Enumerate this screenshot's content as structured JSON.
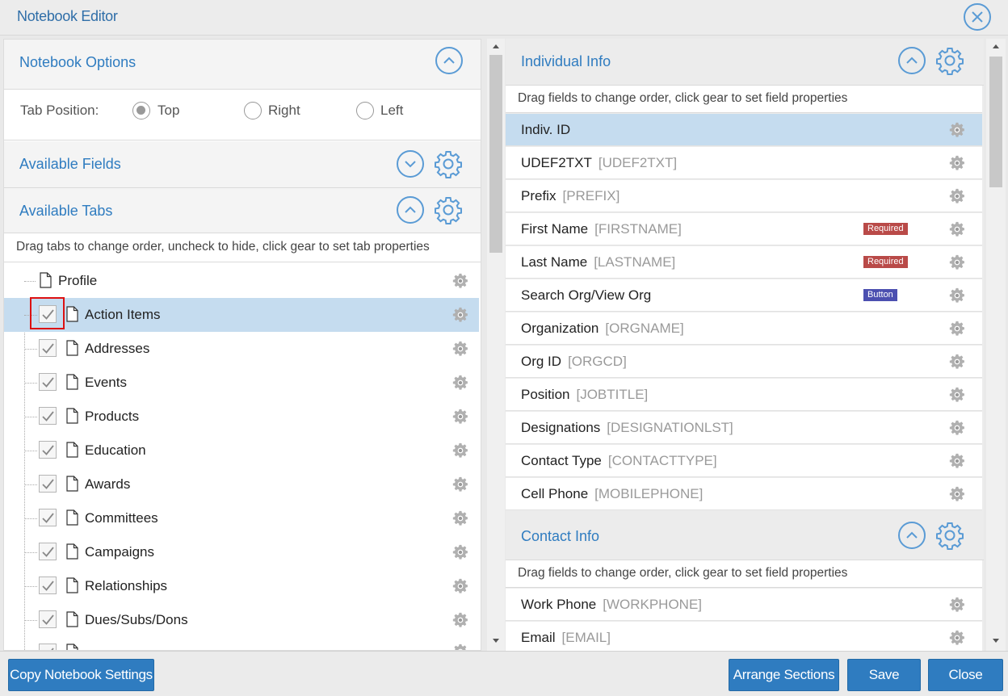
{
  "window": {
    "title": "Notebook Editor"
  },
  "icons": {
    "close": "close-circle-icon",
    "gear": "gear-icon",
    "chevron_up": "chevron-up-icon",
    "chevron_down": "chevron-down-icon",
    "document": "document-icon",
    "checkmark": "check-icon"
  },
  "colors": {
    "accent": "#2f7cc0",
    "selected_row": "#c5dcef",
    "required_badge": "#b94a48",
    "button_badge": "#4b4fb0"
  },
  "left": {
    "notebook_options": {
      "title": "Notebook Options",
      "tab_position_label": "Tab Position:",
      "options": [
        "Top",
        "Right",
        "Left"
      ],
      "selected": "Top"
    },
    "available_fields": {
      "title": "Available Fields"
    },
    "available_tabs": {
      "title": "Available Tabs",
      "hint": "Drag tabs to change order, uncheck to hide, click gear to set tab properties",
      "root": "Profile",
      "tabs": [
        {
          "label": "Action Items",
          "checked": true,
          "selected": true
        },
        {
          "label": "Addresses",
          "checked": true
        },
        {
          "label": "Events",
          "checked": true
        },
        {
          "label": "Products",
          "checked": true
        },
        {
          "label": "Education",
          "checked": true
        },
        {
          "label": "Awards",
          "checked": true
        },
        {
          "label": "Committees",
          "checked": true
        },
        {
          "label": "Campaigns",
          "checked": true
        },
        {
          "label": "Relationships",
          "checked": true
        },
        {
          "label": "Dues/Subs/Dons",
          "checked": true
        }
      ]
    }
  },
  "right": {
    "individual_info": {
      "title": "Individual Info",
      "hint": "Drag fields to change order, click gear to set field properties",
      "fields": [
        {
          "label": "Indiv. ID",
          "code": "",
          "badge": "",
          "selected": true
        },
        {
          "label": "UDEF2TXT",
          "code": "[UDEF2TXT]",
          "badge": ""
        },
        {
          "label": "Prefix",
          "code": "[PREFIX]",
          "badge": ""
        },
        {
          "label": "First Name",
          "code": "[FIRSTNAME]",
          "badge": "Required"
        },
        {
          "label": "Last Name",
          "code": "[LASTNAME]",
          "badge": "Required"
        },
        {
          "label": "Search Org/View Org",
          "code": "",
          "badge": "Button"
        },
        {
          "label": "Organization",
          "code": "[ORGNAME]",
          "badge": ""
        },
        {
          "label": "Org ID",
          "code": "[ORGCD]",
          "badge": ""
        },
        {
          "label": "Position",
          "code": "[JOBTITLE]",
          "badge": ""
        },
        {
          "label": "Designations",
          "code": "[DESIGNATIONLST]",
          "badge": ""
        },
        {
          "label": "Contact Type",
          "code": "[CONTACTTYPE]",
          "badge": ""
        },
        {
          "label": "Cell Phone",
          "code": "[MOBILEPHONE]",
          "badge": ""
        }
      ]
    },
    "contact_info": {
      "title": "Contact Info",
      "hint": "Drag fields to change order, click gear to set field properties",
      "fields": [
        {
          "label": "Work Phone",
          "code": "[WORKPHONE]",
          "badge": ""
        },
        {
          "label": "Email",
          "code": "[EMAIL]",
          "badge": ""
        }
      ]
    }
  },
  "footer": {
    "copy_settings": "Copy Notebook Settings",
    "arrange_sections": "Arrange Sections",
    "save": "Save",
    "close": "Close"
  }
}
